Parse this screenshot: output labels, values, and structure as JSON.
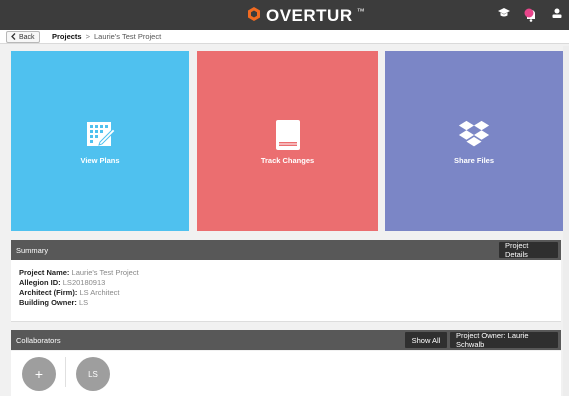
{
  "brand": {
    "name": "OVERTUR",
    "trademark": "™"
  },
  "icons": {
    "brand_logo": "hexagon-logo-icon",
    "help": "graduation-cap-icon",
    "notifications": "notification-bell-icon",
    "user": "user-icon",
    "back_chevron": "chevron-left-icon",
    "view_plans": "blueprint-pencil-icon",
    "track_changes": "book-icon",
    "share_files": "dropbox-icon",
    "add": "plus-icon"
  },
  "colors": {
    "topbar": "#3c3c3c",
    "brand_orange": "#f26b21",
    "view_plans": "#4fc1ef",
    "track_changes": "#eb6e70",
    "share_files": "#7b86c6",
    "panel_header": "#585858",
    "notification_badge": "#e8458b"
  },
  "nav": {
    "back_label": "Back",
    "breadcrumb": {
      "link": "Projects",
      "separator": ">",
      "current": "Laurie's Test Project"
    }
  },
  "tiles": {
    "view_plans": "View Plans",
    "track_changes": "Track Changes",
    "share_files": "Share Files"
  },
  "summary": {
    "title": "Summary",
    "details_button": "Project Details",
    "fields": [
      {
        "label": "Project Name:",
        "value": "Laurie's Test Project"
      },
      {
        "label": "Allegion ID:",
        "value": "LS20180913"
      },
      {
        "label": "Architect (Firm):",
        "value": "LS Architect"
      },
      {
        "label": "Building Owner:",
        "value": "LS"
      }
    ]
  },
  "collaborators": {
    "title": "Collaborators",
    "show_all": "Show All",
    "owner_button": "Project Owner: Laurie Schwalb",
    "add_label": "+",
    "members": [
      "LS"
    ]
  }
}
